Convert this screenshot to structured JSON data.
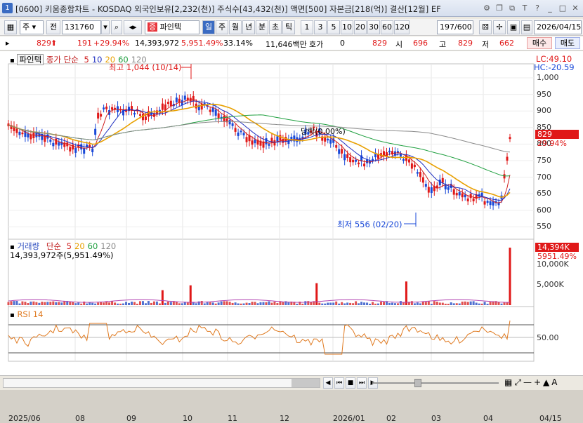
{
  "window": {
    "app_number": "1",
    "title": "[0600] 키움종합차트 - KOSDAQ 외국인보유[2,232(천)] 주식수[43,432(천)] 액면[500] 자본금[218(억)] 결산[12월] EF",
    "ctrl_icons": [
      "gear",
      "restore",
      "menu",
      "T",
      "?",
      "minimize",
      "maximize",
      "close"
    ]
  },
  "toolbar": {
    "type_select": "주",
    "prev_label": "전",
    "code_value": "131760",
    "stock_name": "파인텍",
    "period_buttons": [
      "일",
      "주",
      "월",
      "년",
      "분",
      "초",
      "틱"
    ],
    "period_selected": "일",
    "interval_buttons": [
      "1",
      "3",
      "5",
      "10",
      "20",
      "30",
      "60",
      "120"
    ],
    "page_value": "197/600",
    "date_value": "2026/04/15"
  },
  "infobar": {
    "price": "829",
    "change": "191",
    "change_pct": "+29.94%",
    "volume": "14,393,972",
    "volume_ratio": "5,951.49%",
    "turnover": "33.14%",
    "amount": "11,646백만",
    "quote_label": "호가",
    "quote_value": "0",
    "current": "829",
    "open_label": "시",
    "open": "696",
    "high_label": "고",
    "high": "829",
    "low_label": "저",
    "low": "662",
    "buy_label": "매수",
    "sell_label": "매도"
  },
  "price_pane": {
    "legend_name": "파인텍",
    "legend_ma": "종가 단순",
    "ma_periods": [
      "5",
      "10",
      "20",
      "60",
      "120"
    ],
    "ma_colors": [
      "#d02020",
      "#2030c0",
      "#e8a000",
      "#20a040",
      "#8a8a8a"
    ],
    "high_annotation": "최고 1,044 (10/14)",
    "low_annotation": "최저 556 (02/20)",
    "mid_annotation": "당락(0.00%)",
    "lc_label": "LC:49.10",
    "hc_label": "HC:-20.59",
    "y_ticks": [
      "1,000",
      "950",
      "900",
      "850",
      "800",
      "750",
      "700",
      "650",
      "600",
      "550"
    ],
    "current_price_tag": "829",
    "current_pct_tag": "29.94%"
  },
  "volume_pane": {
    "legend_name": "거래량",
    "legend_ma": "단순",
    "ma_periods": [
      "5",
      "20",
      "60",
      "120"
    ],
    "value_line": "14,393,972주(5,951.49%)",
    "y_ticks": [
      "10,000K",
      "5,000K"
    ],
    "current_tag": "14,394K",
    "current_pct_tag": "5951.49%"
  },
  "rsi_pane": {
    "legend": "RSI 14",
    "y_ticks": [
      "50.00"
    ]
  },
  "x_axis": {
    "labels": [
      "2025/06",
      "08",
      "09",
      "10",
      "11",
      "12",
      "2026/01",
      "02",
      "03",
      "04"
    ],
    "right_label": "04/15"
  },
  "colors": {
    "up": "#e01818",
    "down": "#1848d8",
    "ma5": "#d02020",
    "ma10": "#2030c0",
    "ma20": "#e8a000",
    "ma60": "#20a040",
    "ma120": "#8a8a8a",
    "rsi": "#e07a20"
  }
}
